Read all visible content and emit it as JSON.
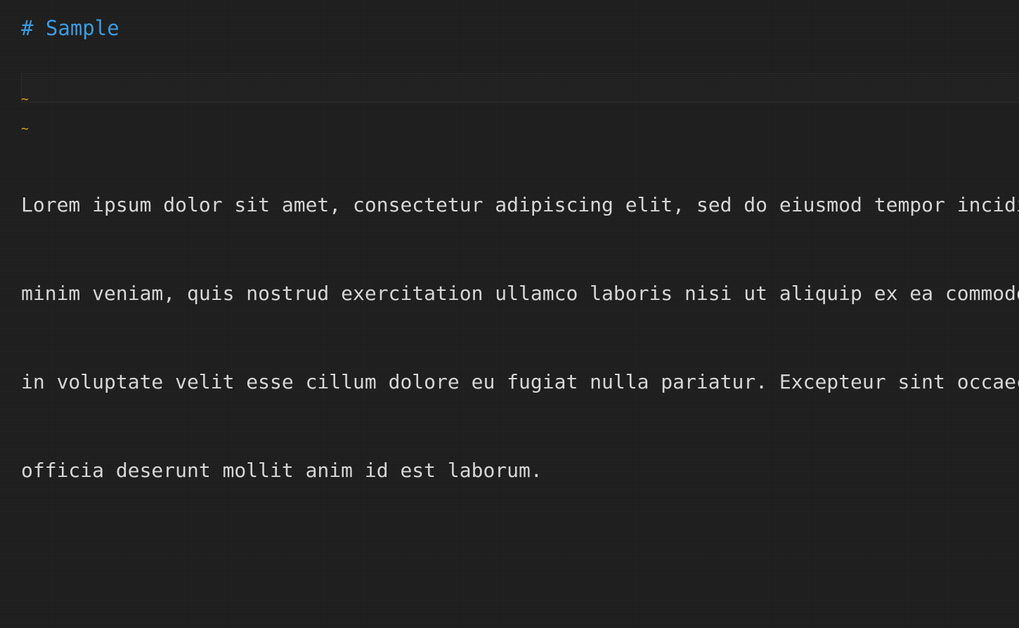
{
  "document": {
    "heading": "# Sample",
    "empty_lines": [
      "~",
      "~"
    ],
    "paragraph_lines": [
      "Lorem ipsum dolor sit amet, consectetur adipiscing elit, sed do eiusmod tempor incidi",
      "minim veniam, quis nostrud exercitation ullamco laboris nisi ut aliquip ex ea commodo",
      "in voluptate velit esse cillum dolore eu fugiat nulla pariatur. Excepteur sint occaec",
      "officia deserunt mollit anim id est laborum."
    ]
  },
  "colors": {
    "background": "#1f1f1f",
    "heading": "#3b9be0",
    "tilde": "#d9a81e",
    "text": "#d6d6d6"
  }
}
